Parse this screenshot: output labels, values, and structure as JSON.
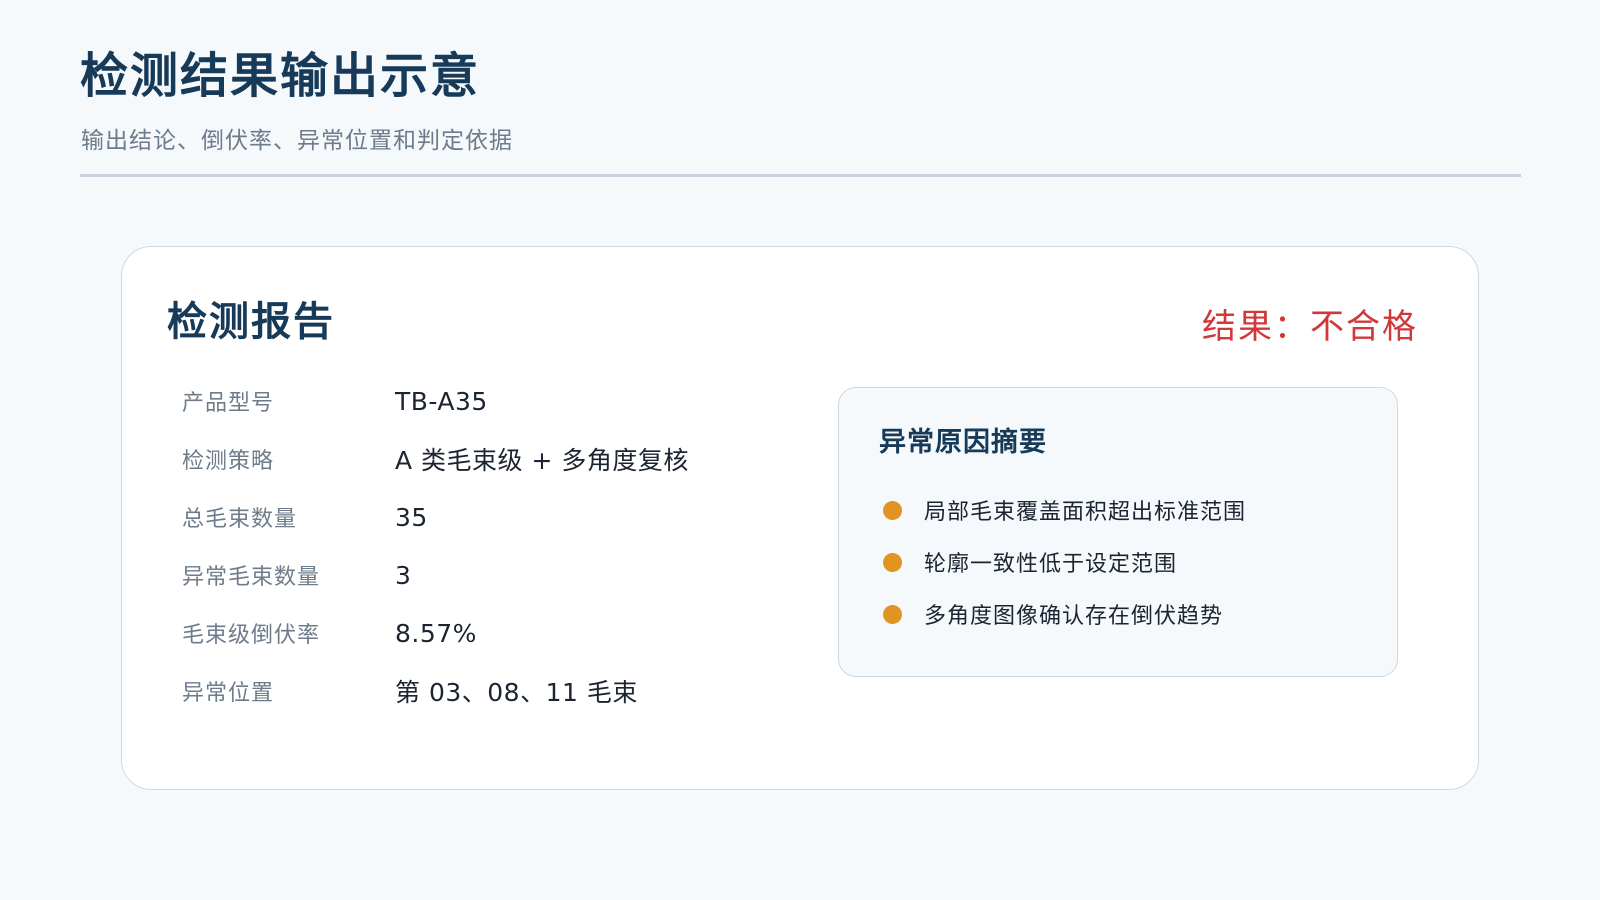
{
  "header": {
    "title": "检测结果输出示意",
    "subtitle": "输出结论、倒伏率、异常位置和判定依据"
  },
  "report": {
    "title": "检测报告",
    "result": "结果：不合格",
    "rows": [
      {
        "label": "产品型号",
        "value": "TB-A35"
      },
      {
        "label": "检测策略",
        "value": "A 类毛束级 + 多角度复核"
      },
      {
        "label": "总毛束数量",
        "value": "35"
      },
      {
        "label": "异常毛束数量",
        "value": "3"
      },
      {
        "label": "毛束级倒伏率",
        "value": "8.57%"
      },
      {
        "label": "异常位置",
        "value": "第 03、08、11 毛束"
      }
    ]
  },
  "summary": {
    "title": "异常原因摘要",
    "items": [
      "局部毛束覆盖面积超出标准范围",
      "轮廓一致性低于设定范围",
      "多角度图像确认存在倒伏趋势"
    ]
  },
  "colors": {
    "title": "#163a58",
    "fail": "#d0383a",
    "bullet": "#e09422"
  }
}
